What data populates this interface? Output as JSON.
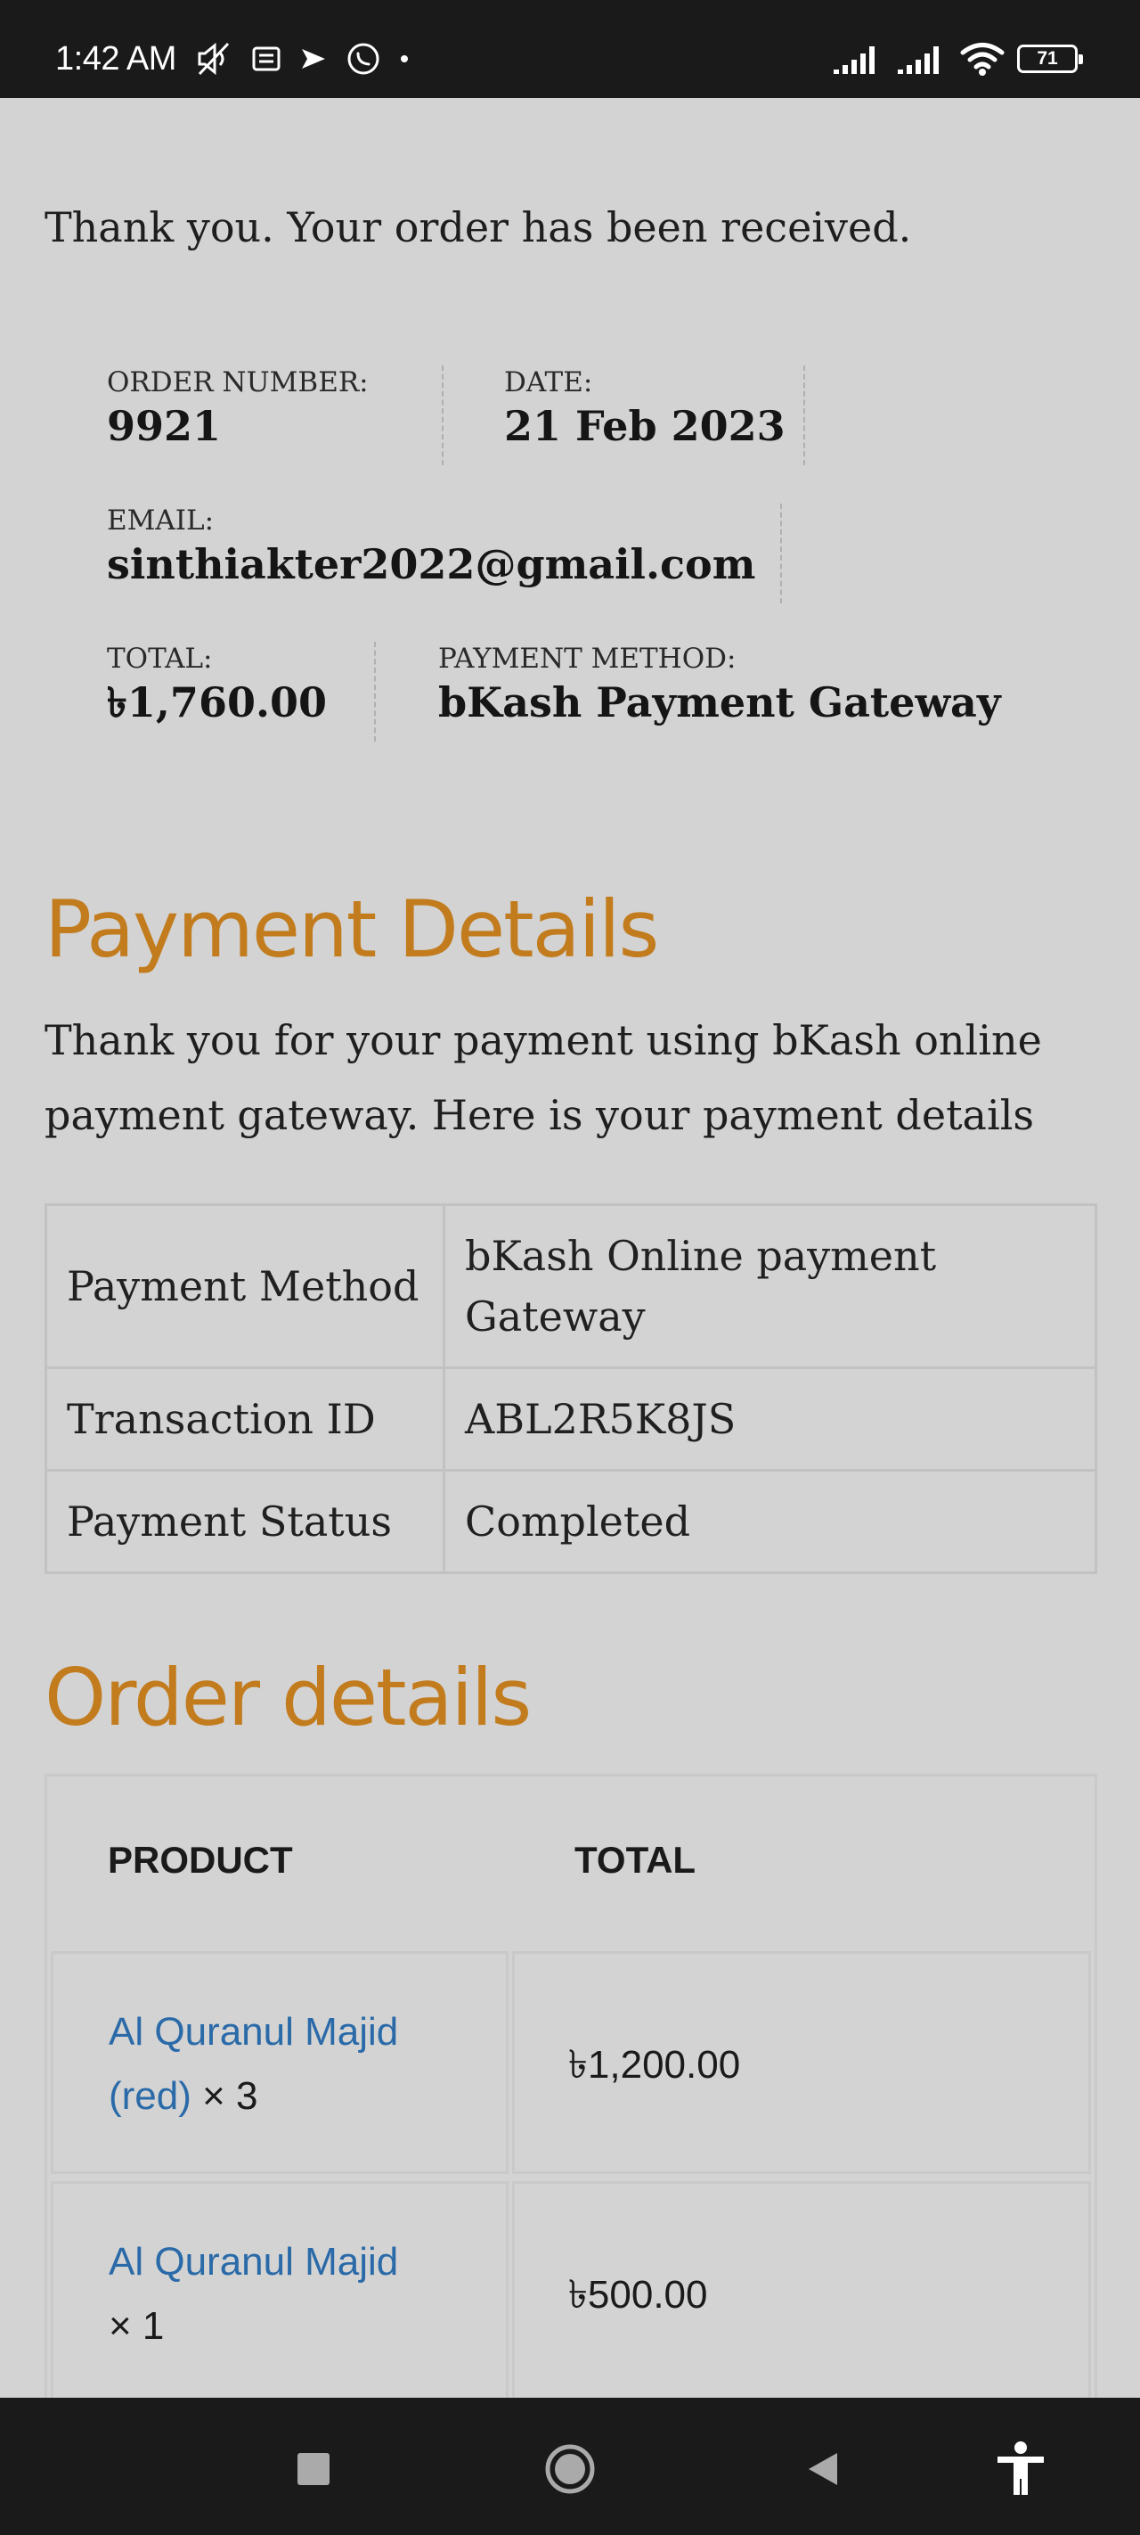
{
  "status_bar": {
    "time": "1:42 AM",
    "battery": "71",
    "icons": [
      "mute-icon",
      "message-icon",
      "send-icon",
      "whatsapp-icon",
      "dot-icon",
      "signal-icon",
      "signal-icon",
      "wifi-icon",
      "battery-icon"
    ]
  },
  "order_overview": {
    "thank_you": "Thank you. Your order has been received.",
    "order_number_label": "ORDER NUMBER:",
    "order_number": "9921",
    "date_label": "DATE:",
    "date": "21 Feb 2023",
    "email_label": "EMAIL:",
    "email": "sinthiakter2022@gmail.com",
    "total_label": "TOTAL:",
    "total": "৳1,760.00",
    "payment_method_label": "PAYMENT METHOD:",
    "payment_method": "bKash Payment Gateway"
  },
  "payment_details": {
    "heading": "Payment Details",
    "intro": "Thank you for your payment using bKash online payment gateway. Here is your payment details",
    "rows": [
      {
        "label": "Payment Method",
        "value": "bKash Online payment Gateway"
      },
      {
        "label": "Transaction ID",
        "value": "ABL2R5K8JS"
      },
      {
        "label": "Payment Status",
        "value": "Completed"
      }
    ]
  },
  "order_details": {
    "heading": "Order details",
    "columns": [
      "PRODUCT",
      "TOTAL"
    ],
    "items": [
      {
        "name": "Al Quranul Majid (red)",
        "qty": "× 3",
        "total": "৳1,200.00"
      },
      {
        "name": "Al Quranul Majid",
        "qty": "× 1",
        "total": "৳500.00"
      }
    ]
  },
  "colors": {
    "heading": "#c27c1e",
    "link": "#2a6aa8",
    "background": "#d3d3d3",
    "system_bars": "#1a1a1a"
  },
  "nav_bar": {
    "icons": [
      "recents-icon",
      "home-icon",
      "back-icon",
      "accessibility-icon"
    ]
  }
}
